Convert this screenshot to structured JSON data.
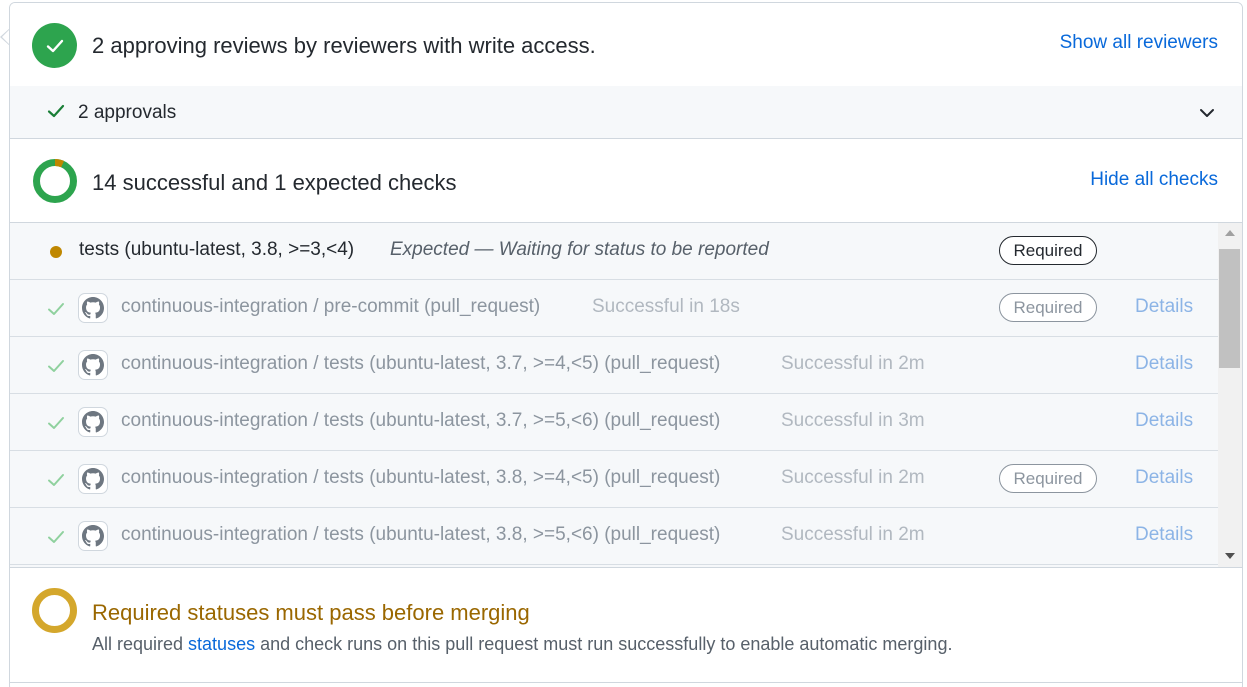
{
  "reviews": {
    "title": "2 approving reviews by reviewers with write access.",
    "show_all_link": "Show all reviewers",
    "approvals_label": "2 approvals"
  },
  "checks": {
    "title": "14 successful and 1 expected checks",
    "hide_all_link": "Hide all checks",
    "rows": [
      {
        "name": "tests (ubuntu-latest, 3.8, >=3,<4)",
        "status": "Expected — Waiting for status to be reported",
        "state": "expected",
        "required": "Required",
        "details": ""
      },
      {
        "name": "continuous-integration / pre-commit (pull_request)",
        "status": "Successful in 18s",
        "state": "success",
        "required": "Required",
        "details": "Details"
      },
      {
        "name": "continuous-integration / tests (ubuntu-latest, 3.7, >=4,<5) (pull_request)",
        "status": "Successful in 2m",
        "state": "success",
        "required": "",
        "details": "Details"
      },
      {
        "name": "continuous-integration / tests (ubuntu-latest, 3.7, >=5,<6) (pull_request)",
        "status": "Successful in 3m",
        "state": "success",
        "required": "",
        "details": "Details"
      },
      {
        "name": "continuous-integration / tests (ubuntu-latest, 3.8, >=4,<5) (pull_request)",
        "status": "Successful in 2m",
        "state": "success",
        "required": "Required",
        "details": "Details"
      },
      {
        "name": "continuous-integration / tests (ubuntu-latest, 3.8, >=5,<6) (pull_request)",
        "status": "Successful in 2m",
        "state": "success",
        "required": "",
        "details": "Details"
      }
    ]
  },
  "merge": {
    "title": "Required statuses must pass before merging",
    "desc_prefix": "All required ",
    "desc_link": "statuses",
    "desc_suffix": " and check runs on this pull request must run successfully to enable automatic merging."
  },
  "colors": {
    "success": "#2da44e",
    "pending": "#bf8700",
    "link": "#0969da",
    "warning_title": "#9a6700"
  },
  "icons": {
    "reviews_status": "check-circle-icon",
    "approvals_check": "check-icon",
    "approvals_toggle": "chevron-down-icon",
    "checks_status": "donut-icon",
    "row_app": "github-icon",
    "merge_status": "pending-ring-icon"
  }
}
